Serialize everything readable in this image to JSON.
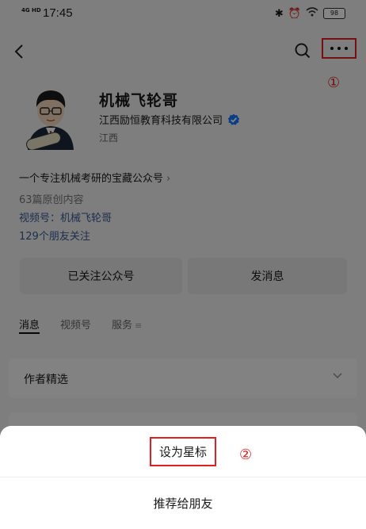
{
  "status_bar": {
    "network": "4G HD",
    "time": "17:45",
    "battery": "98"
  },
  "profile": {
    "name": "机械飞轮哥",
    "company": "江西励恒教育科技有限公司",
    "region": "江西",
    "avatar_badge": "机械飞轮哥",
    "intro": "一个专注机械考研的宝藏公众号",
    "original_count": "63篇原创内容",
    "channel": "视频号：机械飞轮哥",
    "friends_follow": "129个朋友关注"
  },
  "buttons": {
    "followed": "已关注公众号",
    "message": "发消息"
  },
  "tabs": [
    {
      "label": "消息"
    },
    {
      "label": "视频号"
    },
    {
      "label": "服务"
    }
  ],
  "cards": {
    "featured_title": "作者精选"
  },
  "annotations": {
    "one": "①",
    "two": "②"
  },
  "sheet": {
    "star": "设为星标",
    "recommend": "推荐给朋友"
  },
  "icons": [
    "back-icon",
    "search-icon",
    "more-icon",
    "verified-icon",
    "chevron-down-icon",
    "wifi-icon",
    "bluetooth-icon",
    "alarm-icon",
    "battery-icon"
  ],
  "colors": {
    "highlight": "#e02020",
    "link": "#3b5a96",
    "verified": "#1677ff"
  }
}
